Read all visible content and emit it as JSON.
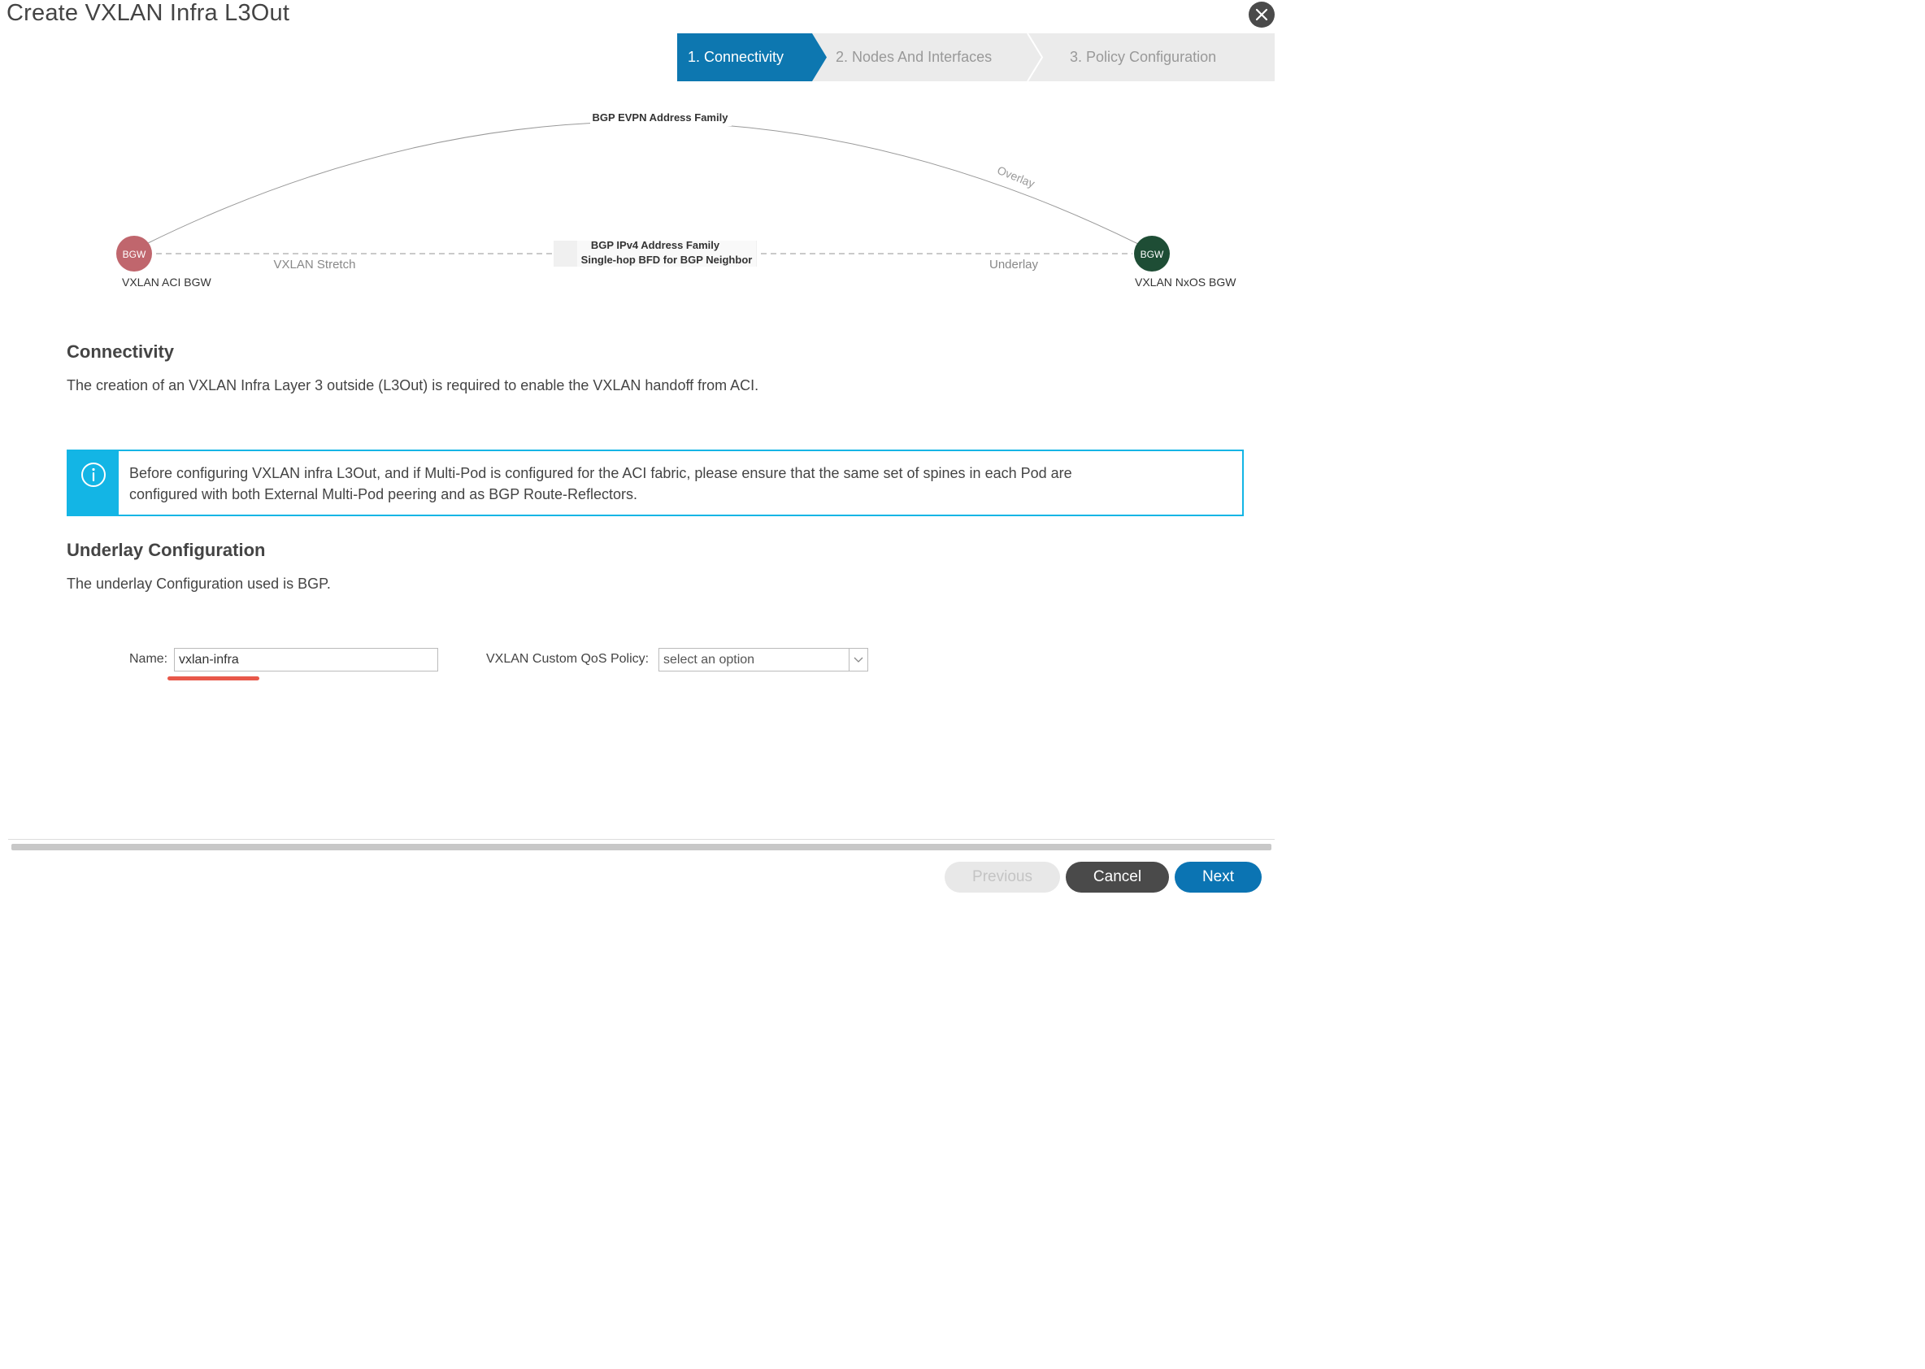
{
  "window": {
    "title": "Create VXLAN Infra L3Out"
  },
  "wizard": {
    "steps": [
      {
        "label": "1. Connectivity",
        "active": true
      },
      {
        "label": "2. Nodes And Interfaces",
        "active": false
      },
      {
        "label": "3. Policy Configuration",
        "active": false
      }
    ]
  },
  "diagram": {
    "overlay_family": "BGP EVPN Address Family",
    "overlay_label": "Overlay",
    "underlay_family": "BGP IPv4 Address Family",
    "underlay_bfd": "Single-hop BFD for BGP Neighbor",
    "stretch_label": "VXLAN Stretch",
    "underlay_label": "Underlay",
    "left_node": {
      "badge": "BGW",
      "name": "VXLAN ACI BGW",
      "color": "#c0666d"
    },
    "right_node": {
      "badge": "BGW",
      "name": "VXLAN NxOS BGW",
      "color": "#1e4d35"
    }
  },
  "connectivity": {
    "title": "Connectivity",
    "description": "The creation of an VXLAN Infra Layer 3 outside (L3Out) is required to enable the VXLAN handoff from ACI."
  },
  "info": {
    "line1": "Before configuring VXLAN infra L3Out, and if Multi-Pod is configured for the ACI fabric, please ensure that the same set of spines in each Pod are",
    "line2": "configured with both External Multi-Pod peering and as BGP Route-Reflectors."
  },
  "underlay": {
    "title": "Underlay Configuration",
    "description": "The underlay Configuration used is BGP."
  },
  "form": {
    "name_label": "Name:",
    "name_value": "vxlan-infra",
    "qos_label": "VXLAN Custom QoS Policy:",
    "qos_placeholder": "select an option"
  },
  "footer": {
    "previous": "Previous",
    "cancel": "Cancel",
    "next": "Next"
  },
  "colors": {
    "accent": "#0d77b0",
    "info": "#13b5e5",
    "step_inactive_bg": "#ebebeb",
    "cancel_bg": "#4a4a4a",
    "next_bg": "#0b74b3",
    "previous_bg": "#e8e8e8"
  }
}
